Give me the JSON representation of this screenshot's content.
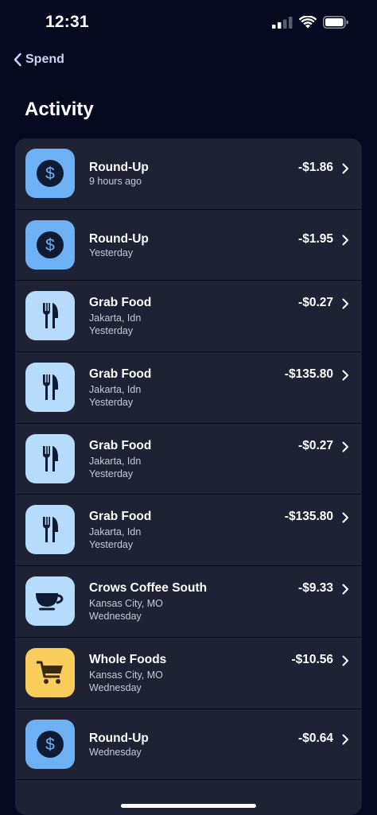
{
  "status": {
    "time": "12:31"
  },
  "nav": {
    "back_label": "Spend"
  },
  "title": "Activity",
  "colors": {
    "background": "#060920",
    "card": "#1f2235",
    "roundup_tile": "#6db1f4",
    "food_tile": "#b7dbfb",
    "grocery_tile": "#f9cc5c",
    "icon_dark": "#0f1a33"
  },
  "transactions": [
    {
      "name": "Round-Up",
      "location": "",
      "time": "9 hours ago",
      "amount": "-$1.86",
      "icon": "dollar-icon"
    },
    {
      "name": "Round-Up",
      "location": "",
      "time": "Yesterday",
      "amount": "-$1.95",
      "icon": "dollar-icon"
    },
    {
      "name": "Grab Food",
      "location": "Jakarta, Idn",
      "time": "Yesterday",
      "amount": "-$0.27",
      "icon": "fork-knife-icon"
    },
    {
      "name": "Grab Food",
      "location": "Jakarta, Idn",
      "time": "Yesterday",
      "amount": "-$135.80",
      "icon": "fork-knife-icon"
    },
    {
      "name": "Grab Food",
      "location": "Jakarta, Idn",
      "time": "Yesterday",
      "amount": "-$0.27",
      "icon": "fork-knife-icon"
    },
    {
      "name": "Grab Food",
      "location": "Jakarta, Idn",
      "time": "Yesterday",
      "amount": "-$135.80",
      "icon": "fork-knife-icon"
    },
    {
      "name": "Crows Coffee South",
      "location": "Kansas City, MO",
      "time": "Wednesday",
      "amount": "-$9.33",
      "icon": "coffee-cup-icon"
    },
    {
      "name": "Whole Foods",
      "location": "Kansas City, MO",
      "time": "Wednesday",
      "amount": "-$10.56",
      "icon": "shopping-cart-icon"
    },
    {
      "name": "Round-Up",
      "location": "",
      "time": "Wednesday",
      "amount": "-$0.64",
      "icon": "dollar-icon"
    }
  ]
}
